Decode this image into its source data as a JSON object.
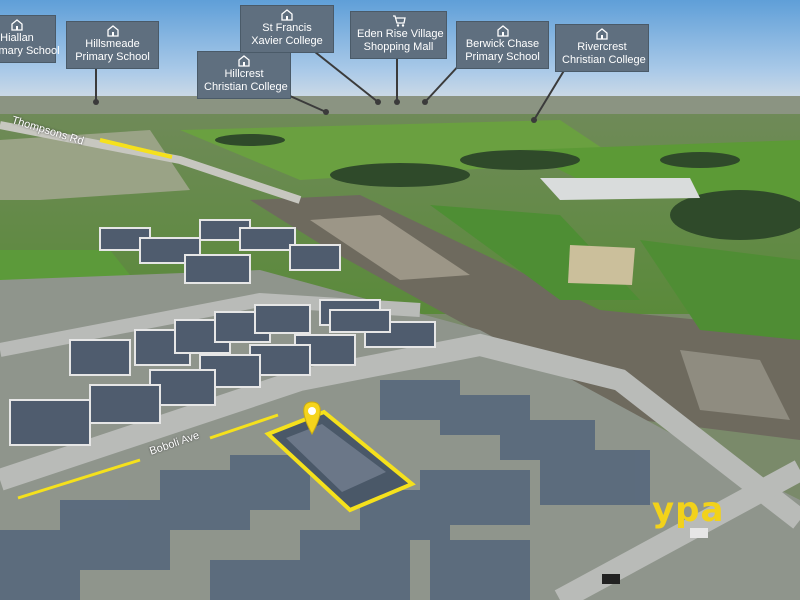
{
  "poi_labels": [
    {
      "line1": "Hiallan",
      "line2": "Primary School",
      "icon": "school-icon"
    },
    {
      "line1": "Hillsmeade",
      "line2": "Primary School",
      "icon": "school-icon"
    },
    {
      "line1": "Hillcrest",
      "line2": "Christian College",
      "icon": "school-icon"
    },
    {
      "line1": "St Francis",
      "line2": "Xavier College",
      "icon": "school-icon"
    },
    {
      "line1": "Eden Rise Village",
      "line2": "Shopping Mall",
      "icon": "shopping-cart-icon"
    },
    {
      "line1": "Berwick Chase",
      "line2": "Primary School",
      "icon": "school-icon"
    },
    {
      "line1": "Rivercrest",
      "line2": "Christian College",
      "icon": "school-icon"
    }
  ],
  "roads": {
    "thompsons": "Thompsons Rd",
    "boboli": "Boboli Ave"
  },
  "brand": "ypa",
  "colors": {
    "highlight": "#f5e11c",
    "label_bg": "#5f6f7f",
    "marker": "#f5d41c",
    "sky": "#6ea8dc"
  }
}
